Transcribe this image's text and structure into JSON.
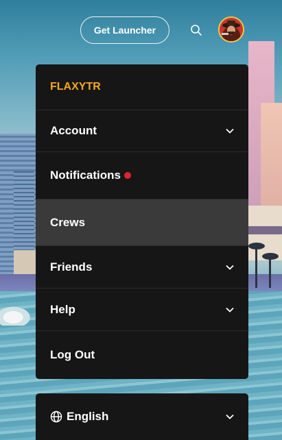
{
  "header": {
    "launcher_button": "Get Launcher",
    "search_icon": "search-icon",
    "avatar": "user-avatar"
  },
  "menu": {
    "username": "FLAXYTR",
    "items": [
      {
        "label": "Account",
        "icon": "chevron-down-icon",
        "expandable": true
      },
      {
        "label": "Notifications",
        "badge": "red-dot",
        "expandable": false
      },
      {
        "label": "Crews",
        "active": true,
        "expandable": false
      },
      {
        "label": "Friends",
        "icon": "chevron-down-icon",
        "expandable": true
      },
      {
        "label": "Help",
        "icon": "chevron-down-icon",
        "expandable": true
      },
      {
        "label": "Log Out",
        "expandable": false
      }
    ]
  },
  "language": {
    "label": "English",
    "icon": "globe-icon",
    "dropdown_icon": "chevron-down-icon"
  },
  "colors": {
    "username": "#f5a81e",
    "menu_bg": "#161616",
    "active_item_bg": "#3a3a3a",
    "notification_dot": "#e0242b"
  }
}
